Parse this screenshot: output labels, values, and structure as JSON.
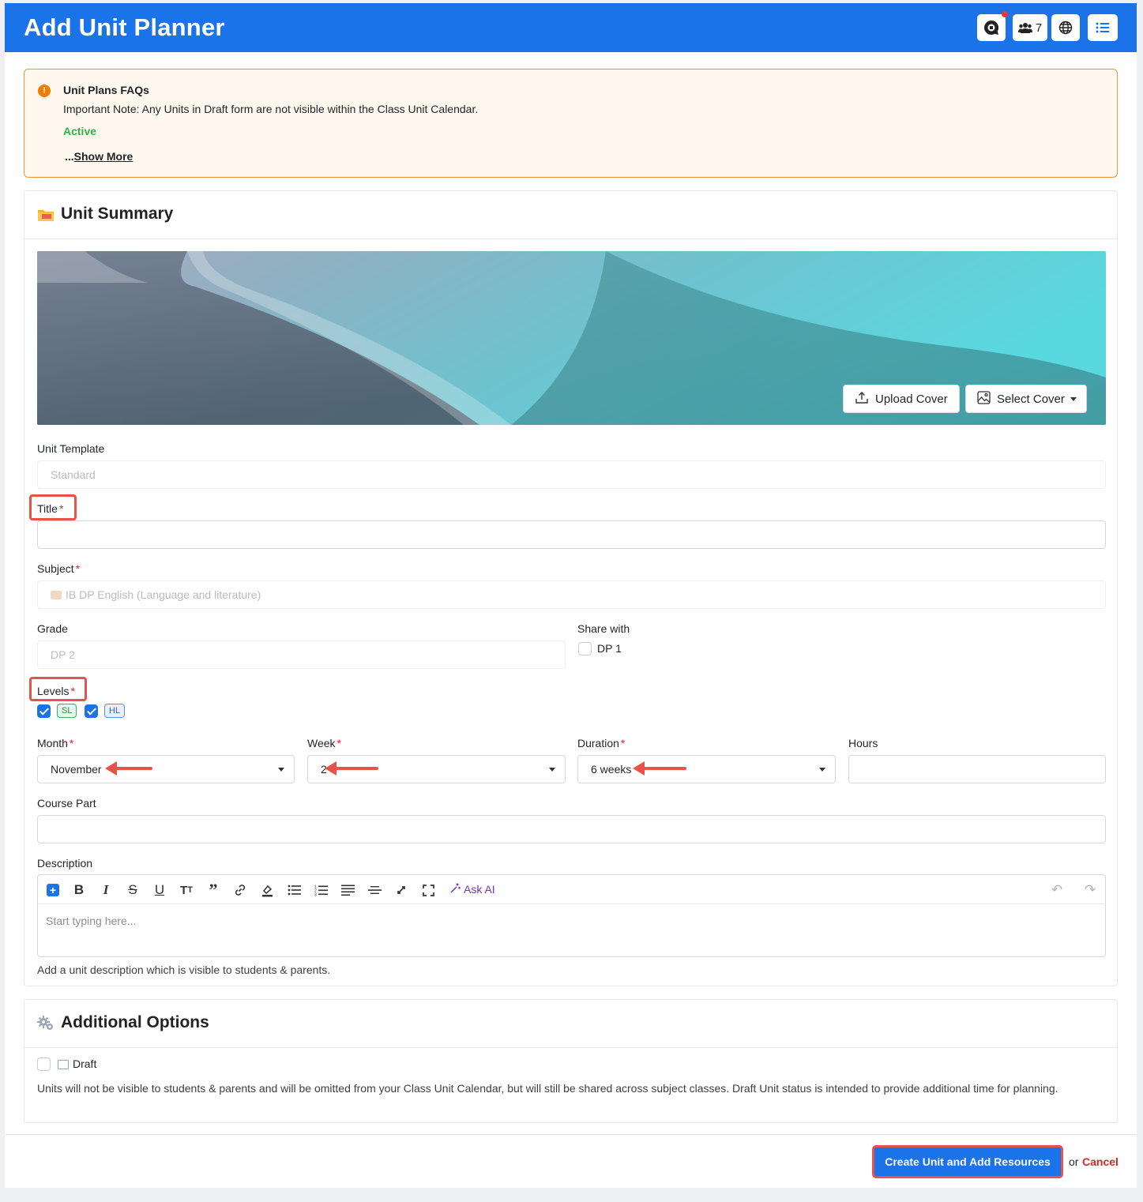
{
  "header": {
    "title": "Add Unit Planner",
    "people_count": "7",
    "brand_color": "#1a73e8"
  },
  "alert": {
    "title": "Unit Plans FAQs",
    "note": "Important Note: Any Units in Draft form are not visible within the Class Unit Calendar.",
    "status": "Active",
    "show_more_prefix": "...",
    "show_more": "Show More"
  },
  "summary": {
    "heading": "Unit Summary",
    "upload_cover": "Upload Cover",
    "select_cover": "Select Cover",
    "unit_template_label": "Unit Template",
    "unit_template_value": "Standard",
    "title_label": "Title",
    "title_value": "",
    "subject_label": "Subject",
    "subject_value": "IB DP English (Language and literature)",
    "grade_label": "Grade",
    "grade_value": "DP 2",
    "share_with_label": "Share with",
    "share_with_option": "DP 1",
    "levels_label": "Levels",
    "levels": [
      {
        "label": "SL",
        "checked": true
      },
      {
        "label": "HL",
        "checked": true
      }
    ],
    "month_label": "Month",
    "month_value": "November",
    "week_label": "Week",
    "week_value": "2",
    "duration_label": "Duration",
    "duration_value": "6 weeks",
    "hours_label": "Hours",
    "hours_value": "",
    "course_part_label": "Course Part",
    "course_part_value": "",
    "description_label": "Description",
    "editor_placeholder": "Start typing here...",
    "ask_ai": "Ask AI",
    "description_hint": "Add a unit description which is visible to students & parents.",
    "required_mark": "*"
  },
  "additional": {
    "heading": "Additional Options",
    "draft_label": "Draft",
    "draft_checked": false,
    "draft_hint": "Units will not be visible to students & parents and will be omitted from your Class Unit Calendar, but will still be shared across subject classes. Draft Unit status is intended to provide additional time for planning."
  },
  "footer": {
    "submit": "Create Unit and Add Resources",
    "or": "or",
    "cancel": "Cancel"
  },
  "icons": {
    "header": [
      "chat-icon",
      "people-icon",
      "globe-icon",
      "list-icon"
    ],
    "toolbar": [
      "add-icon",
      "bold-icon",
      "italic-icon",
      "strikethrough-icon",
      "underline-icon",
      "text-size-icon",
      "quote-icon",
      "link-icon",
      "highlight-icon",
      "bullet-list-icon",
      "numbered-list-icon",
      "align-icon",
      "horizontal-rule-icon",
      "clear-format-icon",
      "fullscreen-icon",
      "magic-wand-icon",
      "undo-icon",
      "redo-icon"
    ]
  }
}
